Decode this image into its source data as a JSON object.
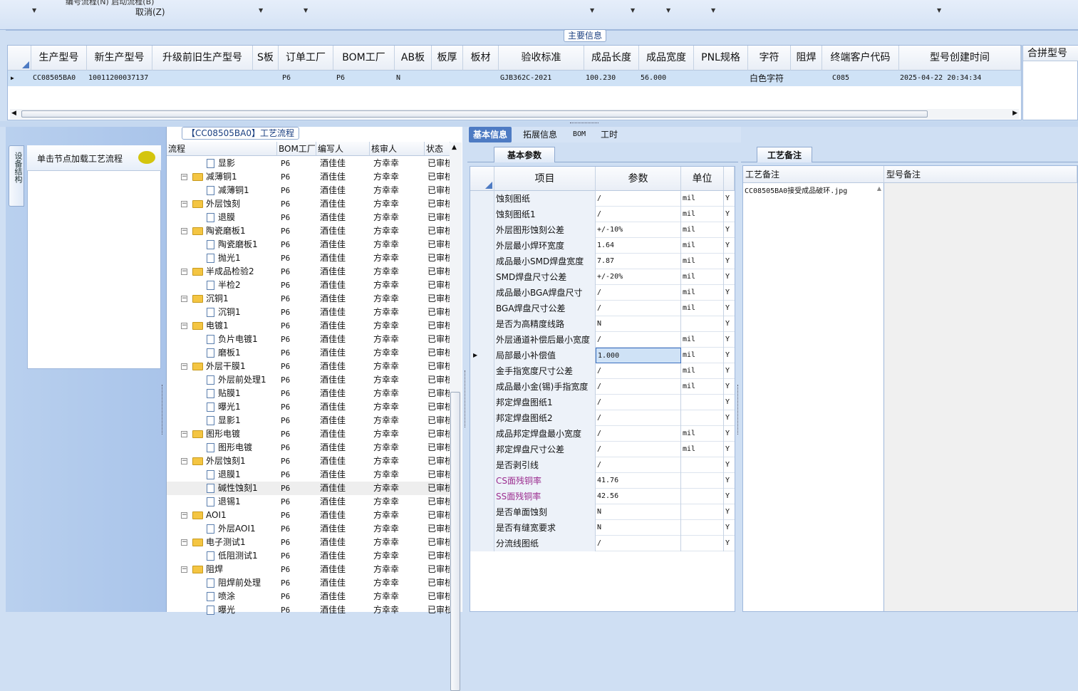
{
  "top": {
    "partial_text": "编号流程(N)   启动流程(B)",
    "cancel": "取消(Z)"
  },
  "main_section": {
    "label": "主要信息"
  },
  "main_grid": {
    "columns": [
      "生产型号",
      "新生产型号",
      "升级前旧生产型号",
      "S板",
      "订单工厂",
      "BOM工厂",
      "AB板",
      "板厚",
      "板材",
      "验收标准",
      "成品长度",
      "成品宽度",
      "PNL规格",
      "字符",
      "阻焊",
      "终端客户代码",
      "型号创建时间"
    ],
    "row": [
      "CC08505BA0",
      "10011200037137",
      "",
      "",
      "P6",
      "P6",
      "N",
      "",
      "",
      "GJB362C-2021",
      "100.230",
      "56.000",
      "",
      "白色字符",
      "",
      "C085",
      "2025-04-22 20:34:34"
    ],
    "extra_header": "合拼型号"
  },
  "left": {
    "vertical_tab": "设备结构",
    "load_text": "单击节点加载工艺流程"
  },
  "process": {
    "tab_label": "【CC08505BA0】工艺流程",
    "columns": [
      "流程",
      "BOM工厂",
      "编写人",
      "核审人",
      "状态"
    ],
    "rows": [
      {
        "name": "显影",
        "level": 2,
        "factory": "P6",
        "writer": "酒佳佳",
        "reviewer": "方幸幸",
        "status": "已审核"
      },
      {
        "name": "减薄铜1",
        "level": 1,
        "factory": "P6",
        "writer": "酒佳佳",
        "reviewer": "方幸幸",
        "status": "已审核"
      },
      {
        "name": "减薄铜1",
        "level": 2,
        "factory": "P6",
        "writer": "酒佳佳",
        "reviewer": "方幸幸",
        "status": "已审核"
      },
      {
        "name": "外层蚀刻",
        "level": 1,
        "factory": "P6",
        "writer": "酒佳佳",
        "reviewer": "方幸幸",
        "status": "已审核"
      },
      {
        "name": "退膜",
        "level": 2,
        "factory": "P6",
        "writer": "酒佳佳",
        "reviewer": "方幸幸",
        "status": "已审核"
      },
      {
        "name": "陶瓷磨板1",
        "level": 1,
        "factory": "P6",
        "writer": "酒佳佳",
        "reviewer": "方幸幸",
        "status": "已审核"
      },
      {
        "name": "陶瓷磨板1",
        "level": 2,
        "factory": "P6",
        "writer": "酒佳佳",
        "reviewer": "方幸幸",
        "status": "已审核"
      },
      {
        "name": "抛光1",
        "level": 2,
        "factory": "P6",
        "writer": "酒佳佳",
        "reviewer": "方幸幸",
        "status": "已审核"
      },
      {
        "name": "半成品检验2",
        "level": 1,
        "factory": "P6",
        "writer": "酒佳佳",
        "reviewer": "方幸幸",
        "status": "已审核"
      },
      {
        "name": "半检2",
        "level": 2,
        "factory": "P6",
        "writer": "酒佳佳",
        "reviewer": "方幸幸",
        "status": "已审核"
      },
      {
        "name": "沉铜1",
        "level": 1,
        "factory": "P6",
        "writer": "酒佳佳",
        "reviewer": "方幸幸",
        "status": "已审核"
      },
      {
        "name": "沉铜1",
        "level": 2,
        "factory": "P6",
        "writer": "酒佳佳",
        "reviewer": "方幸幸",
        "status": "已审核"
      },
      {
        "name": "电镀1",
        "level": 1,
        "factory": "P6",
        "writer": "酒佳佳",
        "reviewer": "方幸幸",
        "status": "已审核"
      },
      {
        "name": "负片电镀1",
        "level": 2,
        "factory": "P6",
        "writer": "酒佳佳",
        "reviewer": "方幸幸",
        "status": "已审核"
      },
      {
        "name": "磨板1",
        "level": 2,
        "factory": "P6",
        "writer": "酒佳佳",
        "reviewer": "方幸幸",
        "status": "已审核"
      },
      {
        "name": "外层干膜1",
        "level": 1,
        "factory": "P6",
        "writer": "酒佳佳",
        "reviewer": "方幸幸",
        "status": "已审核"
      },
      {
        "name": "外层前处理1",
        "level": 2,
        "factory": "P6",
        "writer": "酒佳佳",
        "reviewer": "方幸幸",
        "status": "已审核"
      },
      {
        "name": "贴膜1",
        "level": 2,
        "factory": "P6",
        "writer": "酒佳佳",
        "reviewer": "方幸幸",
        "status": "已审核"
      },
      {
        "name": "曝光1",
        "level": 2,
        "factory": "P6",
        "writer": "酒佳佳",
        "reviewer": "方幸幸",
        "status": "已审核"
      },
      {
        "name": "显影1",
        "level": 2,
        "factory": "P6",
        "writer": "酒佳佳",
        "reviewer": "方幸幸",
        "status": "已审核"
      },
      {
        "name": "图形电镀",
        "level": 1,
        "factory": "P6",
        "writer": "酒佳佳",
        "reviewer": "方幸幸",
        "status": "已审核"
      },
      {
        "name": "图形电镀",
        "level": 2,
        "factory": "P6",
        "writer": "酒佳佳",
        "reviewer": "方幸幸",
        "status": "已审核"
      },
      {
        "name": "外层蚀刻1",
        "level": 1,
        "factory": "P6",
        "writer": "酒佳佳",
        "reviewer": "方幸幸",
        "status": "已审核"
      },
      {
        "name": "退膜1",
        "level": 2,
        "factory": "P6",
        "writer": "酒佳佳",
        "reviewer": "方幸幸",
        "status": "已审核"
      },
      {
        "name": "碱性蚀刻1",
        "level": 2,
        "factory": "P6",
        "writer": "酒佳佳",
        "reviewer": "方幸幸",
        "status": "已审核"
      },
      {
        "name": "退锡1",
        "level": 2,
        "factory": "P6",
        "writer": "酒佳佳",
        "reviewer": "方幸幸",
        "status": "已审核"
      },
      {
        "name": "AOI1",
        "level": 1,
        "factory": "P6",
        "writer": "酒佳佳",
        "reviewer": "方幸幸",
        "status": "已审核"
      },
      {
        "name": "外层AOI1",
        "level": 2,
        "factory": "P6",
        "writer": "酒佳佳",
        "reviewer": "方幸幸",
        "status": "已审核"
      },
      {
        "name": "电子测试1",
        "level": 1,
        "factory": "P6",
        "writer": "酒佳佳",
        "reviewer": "方幸幸",
        "status": "已审核"
      },
      {
        "name": "低阻测试1",
        "level": 2,
        "factory": "P6",
        "writer": "酒佳佳",
        "reviewer": "方幸幸",
        "status": "已审核"
      },
      {
        "name": "阻焊",
        "level": 1,
        "factory": "P6",
        "writer": "酒佳佳",
        "reviewer": "方幸幸",
        "status": "已审核"
      },
      {
        "name": "阻焊前处理",
        "level": 2,
        "factory": "P6",
        "writer": "酒佳佳",
        "reviewer": "方幸幸",
        "status": "已审核"
      },
      {
        "name": "喷涂",
        "level": 2,
        "factory": "P6",
        "writer": "酒佳佳",
        "reviewer": "方幸幸",
        "status": "已审核"
      },
      {
        "name": "曝光",
        "level": 2,
        "factory": "P6",
        "writer": "酒佳佳",
        "reviewer": "方幸幸",
        "status": "已审核"
      }
    ]
  },
  "info_tabs": [
    "基本信息",
    "拓展信息",
    "BOM",
    "工时"
  ],
  "params": {
    "subtab": "基本参数",
    "columns": [
      "项目",
      "参数",
      "单位"
    ],
    "rows": [
      {
        "item": "蚀刻图纸",
        "value": "/",
        "unit": "mil",
        "flag": "Y"
      },
      {
        "item": "蚀刻图纸1",
        "value": "/",
        "unit": "mil",
        "flag": "Y"
      },
      {
        "item": "外层图形蚀刻公差",
        "value": "+/-10%",
        "unit": "mil",
        "flag": "Y"
      },
      {
        "item": "外层最小焊环宽度",
        "value": "1.64",
        "unit": "mil",
        "flag": "Y"
      },
      {
        "item": "成品最小SMD焊盘宽度",
        "value": "7.87",
        "unit": "mil",
        "flag": "Y"
      },
      {
        "item": "SMD焊盘尺寸公差",
        "value": "+/-20%",
        "unit": "mil",
        "flag": "Y"
      },
      {
        "item": "成品最小BGA焊盘尺寸",
        "value": "/",
        "unit": "mil",
        "flag": "Y"
      },
      {
        "item": "BGA焊盘尺寸公差",
        "value": "/",
        "unit": "mil",
        "flag": "Y"
      },
      {
        "item": "是否为高精度线路",
        "value": "N",
        "unit": "",
        "flag": "Y"
      },
      {
        "item": "外层通道补偿后最小宽度",
        "value": "/",
        "unit": "mil",
        "flag": "Y"
      },
      {
        "item": "局部最小补偿值",
        "value": "1.000",
        "unit": "mil",
        "flag": "Y"
      },
      {
        "item": "金手指宽度尺寸公差",
        "value": "/",
        "unit": "mil",
        "flag": "Y"
      },
      {
        "item": "成品最小金(锡)手指宽度",
        "value": "/",
        "unit": "mil",
        "flag": "Y"
      },
      {
        "item": "邦定焊盘图纸1",
        "value": "/",
        "unit": "",
        "flag": "Y"
      },
      {
        "item": "邦定焊盘图纸2",
        "value": "/",
        "unit": "",
        "flag": "Y"
      },
      {
        "item": "成品邦定焊盘最小宽度",
        "value": "/",
        "unit": "mil",
        "flag": "Y"
      },
      {
        "item": "邦定焊盘尺寸公差",
        "value": "/",
        "unit": "mil",
        "flag": "Y"
      },
      {
        "item": "是否剥引线",
        "value": "/",
        "unit": "",
        "flag": "Y"
      },
      {
        "item": "CS面残铜率",
        "value": "41.76",
        "unit": "",
        "flag": "Y"
      },
      {
        "item": "SS面残铜率",
        "value": "42.56",
        "unit": "",
        "flag": "Y"
      },
      {
        "item": "是否单面蚀刻",
        "value": "N",
        "unit": "",
        "flag": "Y"
      },
      {
        "item": "是否有缝宽要求",
        "value": "N",
        "unit": "",
        "flag": "Y"
      },
      {
        "item": "分流线图纸",
        "value": "/",
        "unit": "",
        "flag": "Y"
      }
    ]
  },
  "remarks": {
    "tab": "工艺备注",
    "col1": "工艺备注",
    "col2": "型号备注",
    "entry": "CC08505BA0接受成品破环.jpg"
  },
  "colors": {
    "accent": "#4e7bc3",
    "highlight": "#cfe2f6",
    "purple": "#9b2c8f"
  }
}
